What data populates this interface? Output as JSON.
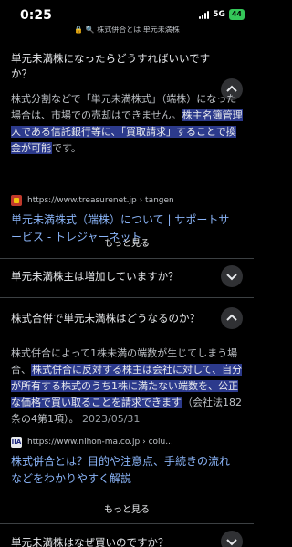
{
  "status": {
    "time": "0:25",
    "network": "5G",
    "battery": "44"
  },
  "url": {
    "lock": "🔒",
    "search": "🔍",
    "text": "株式併合とは 単元未満株"
  },
  "faq": [
    {
      "question": "単元未満株になったらどうすればいいですか？",
      "answer_plain": "株式分割などで「単元未満株式」（端株）になった場合は、市場での売却はできません。",
      "answer_highlight": "株主名簿管理人である信託銀行等に、「買取請求」することで換金が可能",
      "answer_tail": "です。",
      "source_url": "https://www.treasurenet.jp › tangen",
      "result_title": "単元未満株式（端株）について | サポートサービス - トレジャーネット",
      "more": "もっと見る"
    },
    {
      "question": "単元未満株主は増加していますか？"
    },
    {
      "question": "株式合併で単元未満株はどうなるのか？",
      "answer_plain": "株式併合によって1株未満の端数が生じてしまう場合、",
      "answer_highlight": "株式併合に反対する株主は会社に対して、自分が所有する株式のうち1株に満たない端数を、公正な価格で買い取ることを請求できます",
      "answer_tail": "（会社法182条の4第1項）。",
      "date": "2023/05/31",
      "source_badge": "IIA",
      "source_url": "https://www.nihon-ma.co.jp › colu...",
      "result_title": "株式併合とは？目的や注意点、手続きの流れなどをわかりやすく解説",
      "more": "もっと見る"
    },
    {
      "question": "単元未満株はなぜ買いのですか？"
    }
  ]
}
